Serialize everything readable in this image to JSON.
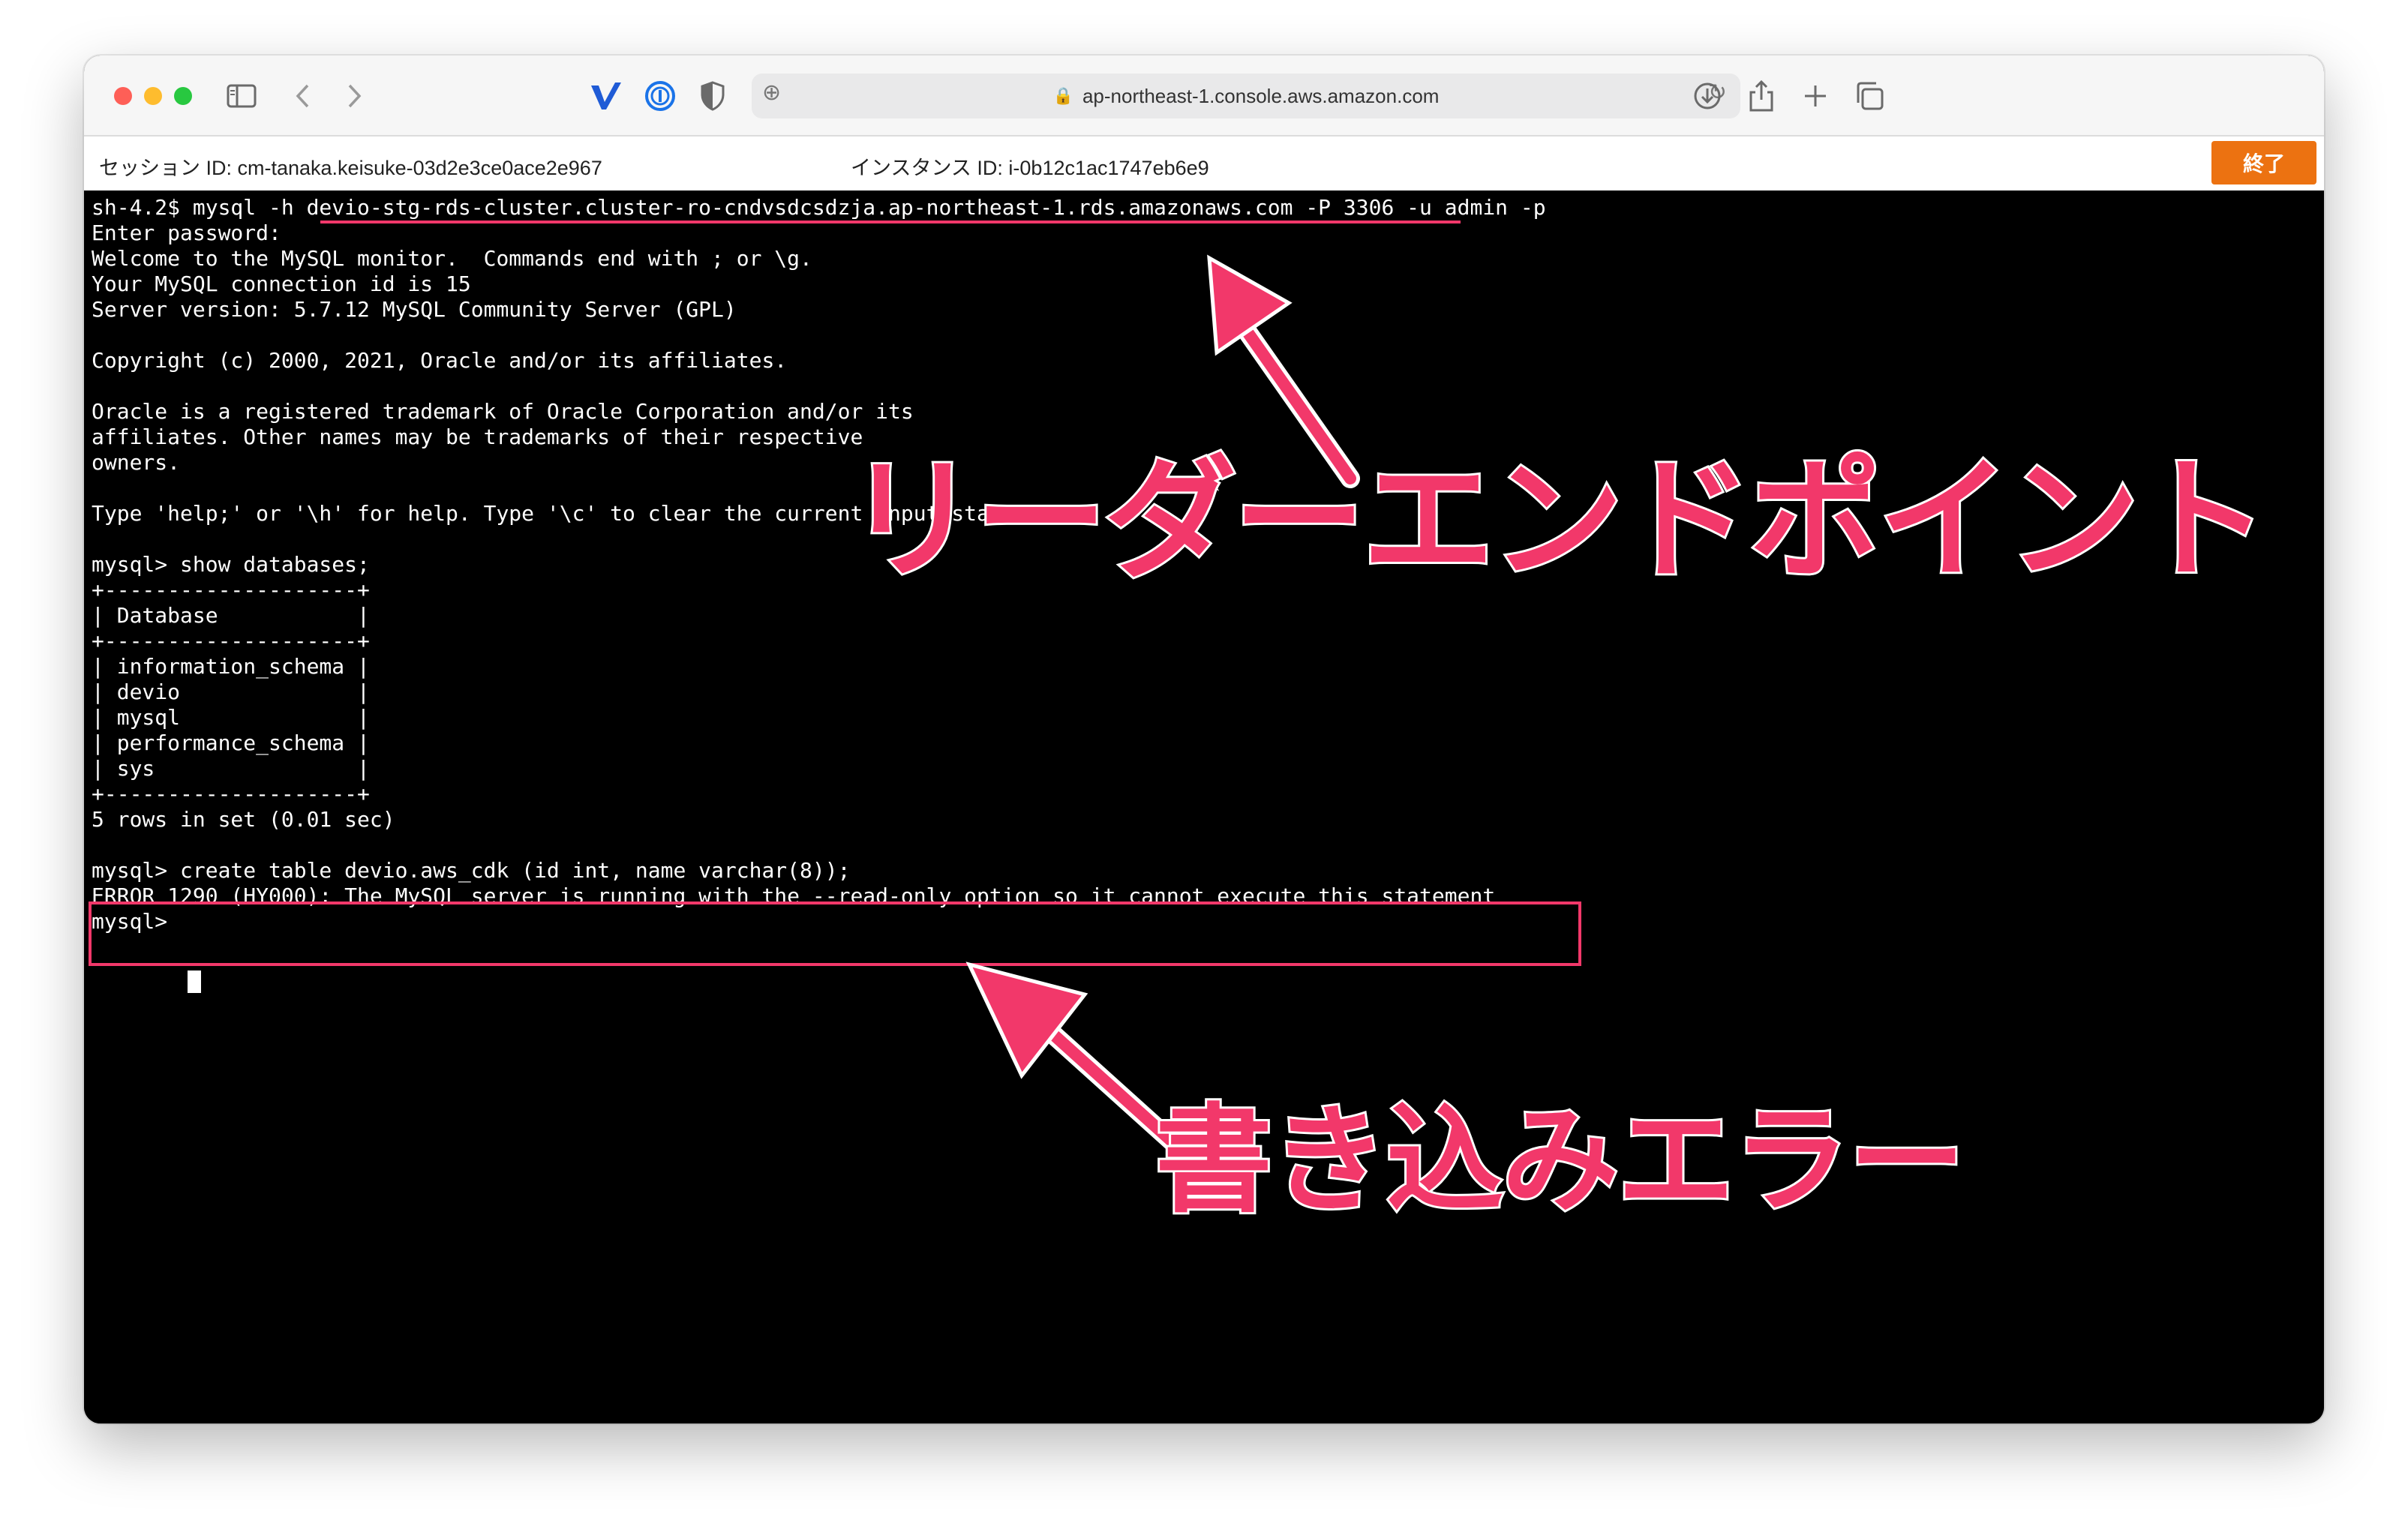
{
  "browser": {
    "url": "ap-northeast-1.console.aws.amazon.com",
    "icons": [
      "sidebar-icon",
      "back-icon",
      "forward-icon",
      "v-extension-icon",
      "password-manager-icon",
      "shield-icon",
      "reload-icon",
      "download-icon",
      "share-icon",
      "new-tab-icon",
      "tab-overview-icon"
    ]
  },
  "session": {
    "session_label": "セッション ID: cm-tanaka.keisuke-03d2e3ce0ace2e967",
    "instance_label": "インスタンス ID: i-0b12c1ac1747eb6e9",
    "end_button": "終了"
  },
  "terminal": {
    "text": "sh-4.2$ mysql -h devio-stg-rds-cluster.cluster-ro-cndvsdcsdzja.ap-northeast-1.rds.amazonaws.com -P 3306 -u admin -p\nEnter password:\nWelcome to the MySQL monitor.  Commands end with ; or \\g.\nYour MySQL connection id is 15\nServer version: 5.7.12 MySQL Community Server (GPL)\n\nCopyright (c) 2000, 2021, Oracle and/or its affiliates.\n\nOracle is a registered trademark of Oracle Corporation and/or its\naffiliates. Other names may be trademarks of their respective\nowners.\n\nType 'help;' or '\\h' for help. Type '\\c' to clear the current input statement.\n\nmysql> show databases;\n+--------------------+\n| Database           |\n+--------------------+\n| information_schema |\n| devio              |\n| mysql              |\n| performance_schema |\n| sys                |\n+--------------------+\n5 rows in set (0.01 sec)\n\nmysql> create table devio.aws_cdk (id int, name varchar(8));\nERROR 1290 (HY000): The MySQL server is running with the --read-only option so it cannot execute this statement\nmysql> "
  },
  "annotations": {
    "reader_endpoint": "リーダーエンドポイント",
    "write_error": "書き込みエラー",
    "color": "#f2386a"
  },
  "colors": {
    "end_button": "#ec7211",
    "terminal_bg": "#000000"
  }
}
